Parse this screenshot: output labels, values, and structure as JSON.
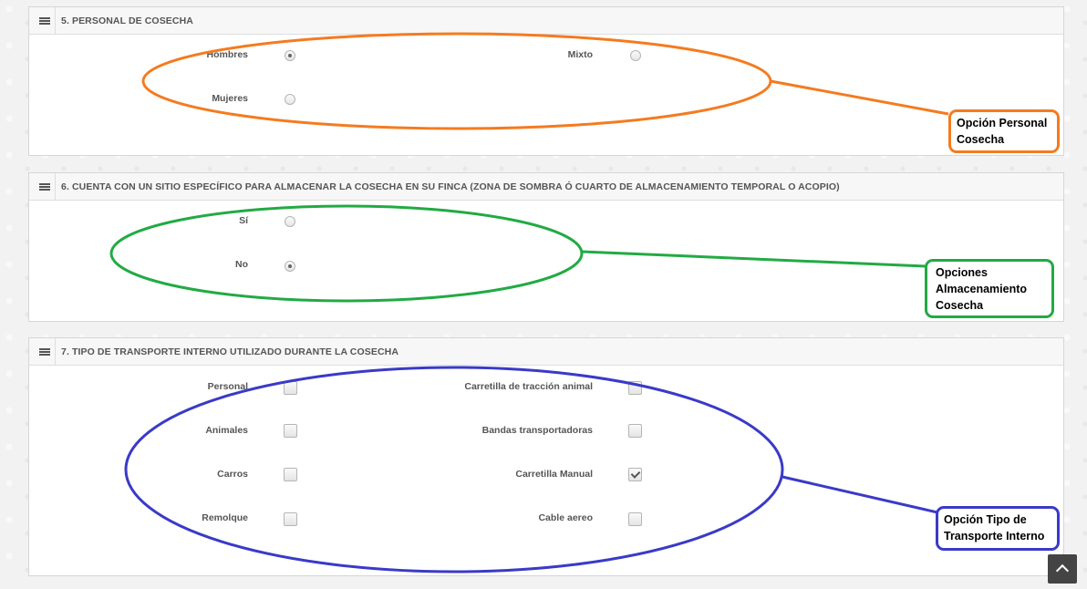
{
  "sections": {
    "personal": {
      "title": "5. PERSONAL DE COSECHA",
      "options": [
        {
          "label": "Hombres",
          "checked": true
        },
        {
          "label": "Mixto",
          "checked": false
        },
        {
          "label": "Mujeres",
          "checked": false
        }
      ]
    },
    "almacenamiento": {
      "title": "6. CUENTA CON UN SITIO ESPECÍFICO PARA ALMACENAR LA COSECHA EN SU FINCA (ZONA DE SOMBRA Ó CUARTO DE ALMACENAMIENTO TEMPORAL O ACOPIO)",
      "options": [
        {
          "label": "Sí",
          "checked": false
        },
        {
          "label": "No",
          "checked": true
        }
      ]
    },
    "transporte": {
      "title": "7. TIPO DE TRANSPORTE INTERNO UTILIZADO DURANTE LA COSECHA",
      "options": [
        {
          "label": "Personal",
          "checked": false
        },
        {
          "label": "Carretilla de tracción animal",
          "checked": false
        },
        {
          "label": "Animales",
          "checked": false
        },
        {
          "label": "Bandas transportadoras",
          "checked": false
        },
        {
          "label": "Carros",
          "checked": false
        },
        {
          "label": "Carretilla Manual",
          "checked": true
        },
        {
          "label": "Remolque",
          "checked": false
        },
        {
          "label": "Cable aereo",
          "checked": false
        }
      ]
    }
  },
  "callouts": {
    "personal": "Opción Personal Cosecha",
    "almacenamiento": "Opciones Almacenamiento Cosecha",
    "transporte": "Opción Tipo de Transporte Interno"
  },
  "colors": {
    "orange": "#f47b20",
    "green": "#22aa44",
    "blue": "#3a3ac8"
  },
  "icons": {
    "panel": "menu-icon",
    "scroll": "chevron-up-icon"
  }
}
